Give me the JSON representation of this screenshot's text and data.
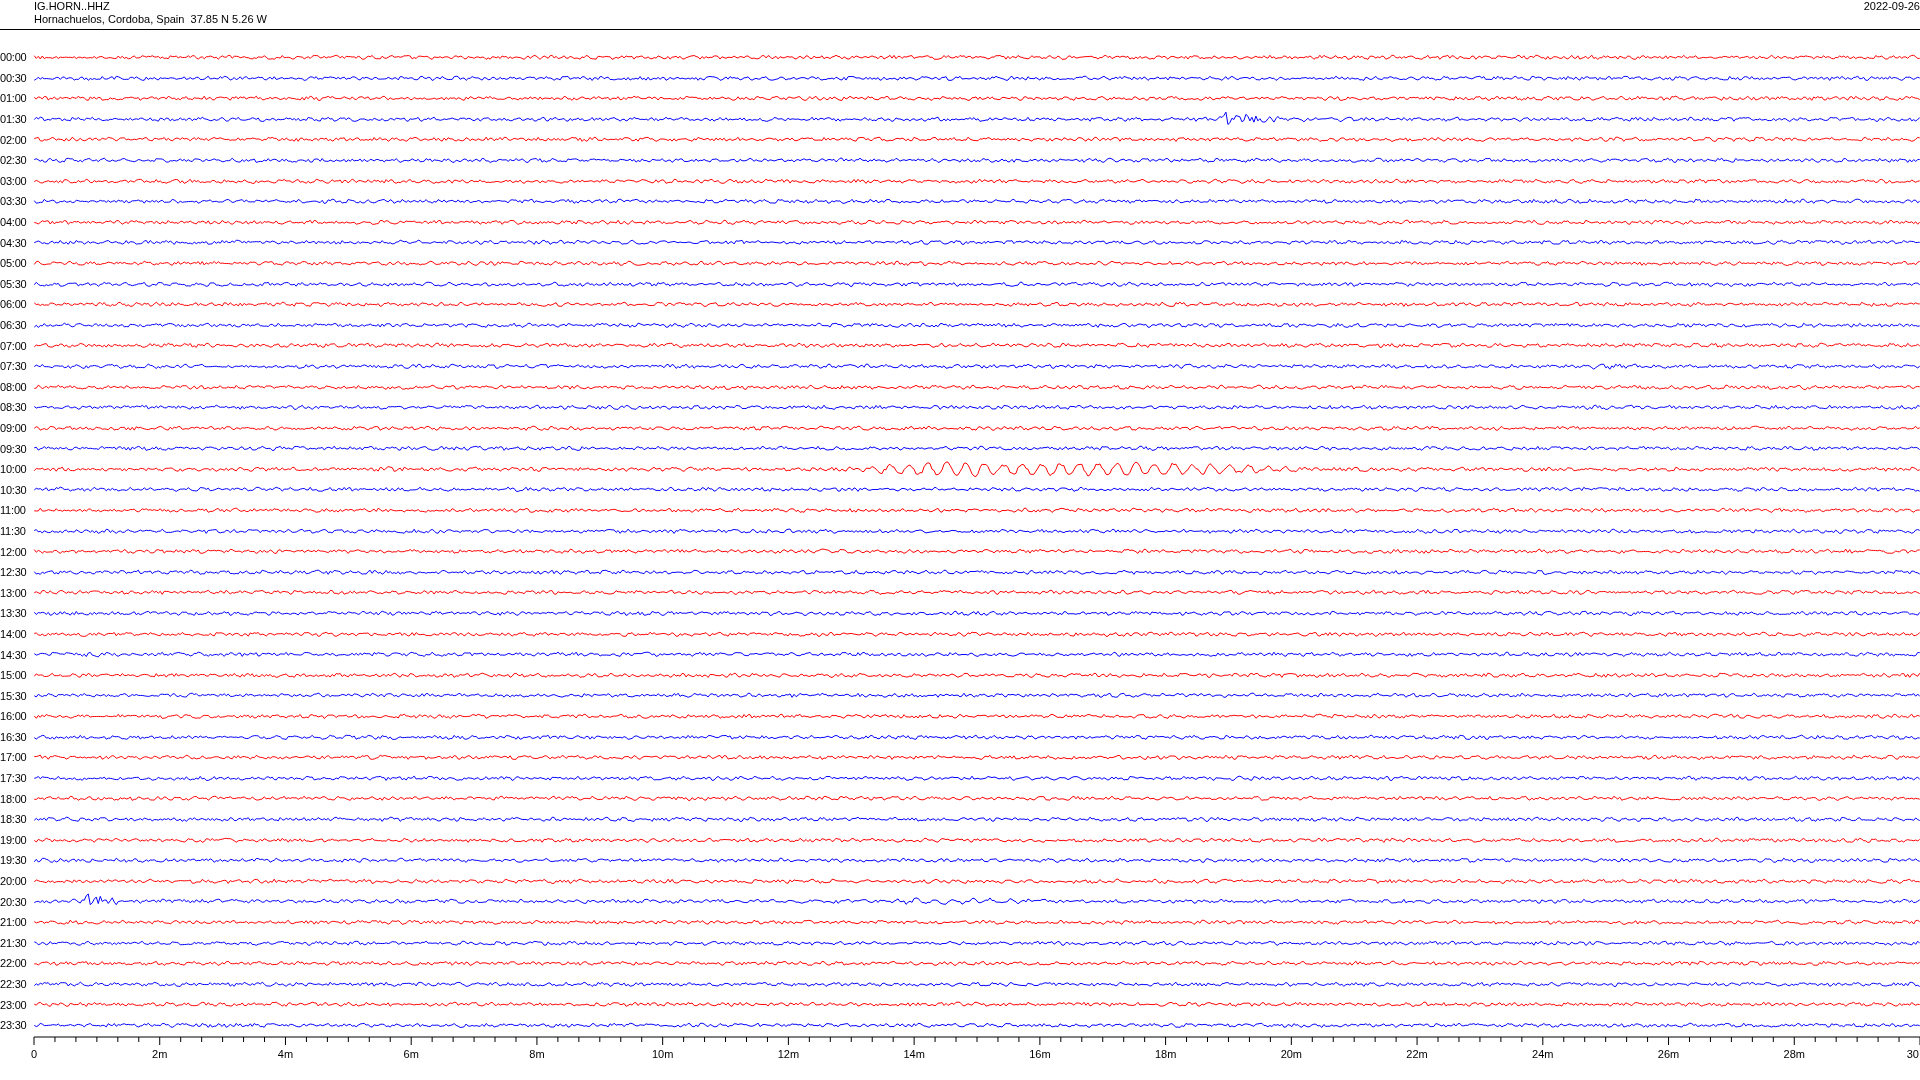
{
  "header": {
    "station": "IG.HORN..HHZ",
    "location": "Hornachuelos, Cordoba, Spain  37.85 N 5.26 W",
    "date": "2022-09-26"
  },
  "rows": [
    {
      "label": "00:00",
      "color": "#ff0000"
    },
    {
      "label": "00:30",
      "color": "#0000ff"
    },
    {
      "label": "01:00",
      "color": "#ff0000"
    },
    {
      "label": "01:30",
      "color": "#0000ff"
    },
    {
      "label": "02:00",
      "color": "#ff0000"
    },
    {
      "label": "02:30",
      "color": "#0000ff"
    },
    {
      "label": "03:00",
      "color": "#ff0000"
    },
    {
      "label": "03:30",
      "color": "#0000ff"
    },
    {
      "label": "04:00",
      "color": "#ff0000"
    },
    {
      "label": "04:30",
      "color": "#0000ff"
    },
    {
      "label": "05:00",
      "color": "#ff0000"
    },
    {
      "label": "05:30",
      "color": "#0000ff"
    },
    {
      "label": "06:00",
      "color": "#ff0000"
    },
    {
      "label": "06:30",
      "color": "#0000ff"
    },
    {
      "label": "07:00",
      "color": "#ff0000"
    },
    {
      "label": "07:30",
      "color": "#0000ff"
    },
    {
      "label": "08:00",
      "color": "#ff0000"
    },
    {
      "label": "08:30",
      "color": "#0000ff"
    },
    {
      "label": "09:00",
      "color": "#ff0000"
    },
    {
      "label": "09:30",
      "color": "#0000ff"
    },
    {
      "label": "10:00",
      "color": "#ff0000"
    },
    {
      "label": "10:30",
      "color": "#0000ff"
    },
    {
      "label": "11:00",
      "color": "#ff0000"
    },
    {
      "label": "11:30",
      "color": "#0000ff"
    },
    {
      "label": "12:00",
      "color": "#ff0000"
    },
    {
      "label": "12:30",
      "color": "#0000ff"
    },
    {
      "label": "13:00",
      "color": "#ff0000"
    },
    {
      "label": "13:30",
      "color": "#0000ff"
    },
    {
      "label": "14:00",
      "color": "#ff0000"
    },
    {
      "label": "14:30",
      "color": "#0000ff"
    },
    {
      "label": "15:00",
      "color": "#ff0000"
    },
    {
      "label": "15:30",
      "color": "#0000ff"
    },
    {
      "label": "16:00",
      "color": "#ff0000"
    },
    {
      "label": "16:30",
      "color": "#0000ff"
    },
    {
      "label": "17:00",
      "color": "#ff0000"
    },
    {
      "label": "17:30",
      "color": "#0000ff"
    },
    {
      "label": "18:00",
      "color": "#ff0000"
    },
    {
      "label": "18:30",
      "color": "#0000ff"
    },
    {
      "label": "19:00",
      "color": "#ff0000"
    },
    {
      "label": "19:30",
      "color": "#0000ff"
    },
    {
      "label": "20:00",
      "color": "#ff0000"
    },
    {
      "label": "20:30",
      "color": "#0000ff"
    },
    {
      "label": "21:00",
      "color": "#ff0000"
    },
    {
      "label": "21:30",
      "color": "#0000ff"
    },
    {
      "label": "22:00",
      "color": "#ff0000"
    },
    {
      "label": "22:30",
      "color": "#0000ff"
    },
    {
      "label": "23:00",
      "color": "#ff0000"
    },
    {
      "label": "23:30",
      "color": "#0000ff"
    }
  ],
  "x_axis": {
    "labels": [
      "0",
      "2m",
      "4m",
      "6m",
      "8m",
      "10m",
      "12m",
      "14m",
      "16m",
      "18m",
      "20m",
      "22m",
      "24m",
      "26m",
      "28m",
      "30"
    ]
  }
}
